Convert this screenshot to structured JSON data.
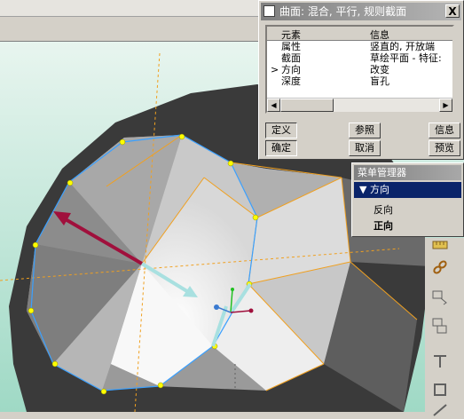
{
  "dialog": {
    "title": "曲面: 混合, 平行, 规则截面",
    "close_label": "X",
    "table": {
      "headers": [
        "元素",
        "信息"
      ],
      "rows": [
        {
          "marker": "",
          "element": "属性",
          "info": "竖直的, 开放端"
        },
        {
          "marker": "",
          "element": "截面",
          "info": "草绘平面 - 特征:"
        },
        {
          "marker": ">",
          "element": "方向",
          "info": "改变"
        },
        {
          "marker": "",
          "element": "深度",
          "info": "盲孔"
        }
      ]
    },
    "buttons": {
      "define": "定义",
      "refs": "参照",
      "info": "信息",
      "ok": "确定",
      "cancel": "取消",
      "preview": "预览"
    }
  },
  "menu_manager": {
    "title": "菜单管理器",
    "selected": "方向",
    "items": [
      "反向",
      "正向"
    ]
  },
  "colors": {
    "viewport_bg": "#cfeee0",
    "surface_dark": "#4a4a4a",
    "surface_light": "#f4f4f4",
    "edge_orange": "#f0a020",
    "edge_blue": "#3aa0ff",
    "vertex_yellow": "#ffff00",
    "arrow_red": "#a0103c",
    "arrow_cyan": "#a8e0e0"
  },
  "icons": {
    "toolstrip": [
      "ruler-icon",
      "chain-icon",
      "sketch-icon",
      "mirror-icon",
      "pattern-icon",
      "square-icon",
      "line-icon"
    ]
  }
}
